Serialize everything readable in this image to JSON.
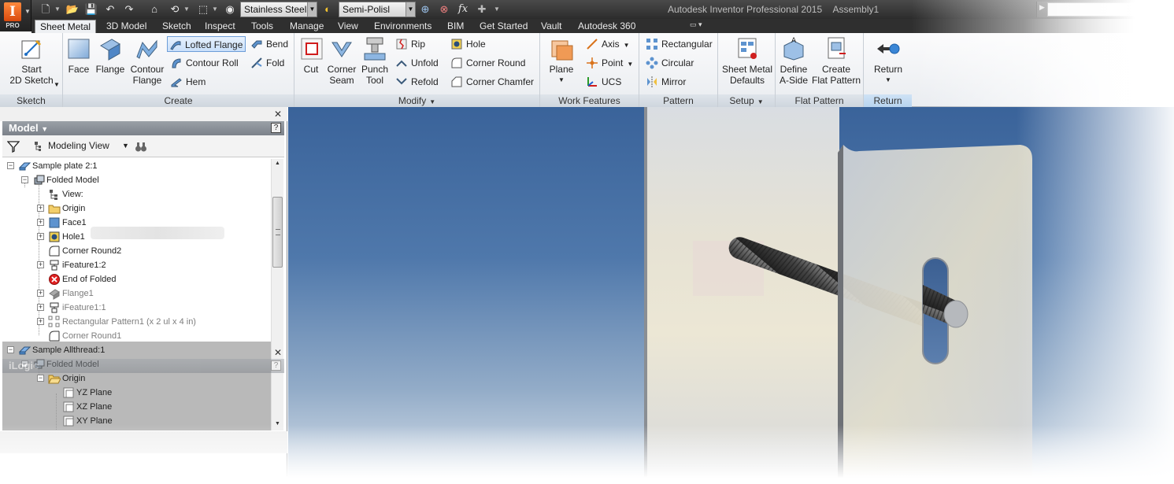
{
  "app": {
    "logo_letter": "I",
    "badge": "PRO",
    "title": "Autodesk Inventor Professional 2015",
    "document": "Assembly1"
  },
  "quick_access": {
    "material": "Stainless Steel",
    "appearance": "Semi-Polisl",
    "fx_label": "fx"
  },
  "tabs": [
    {
      "label": "Sheet Metal",
      "active": true
    },
    {
      "label": "3D Model"
    },
    {
      "label": "Sketch"
    },
    {
      "label": "Inspect"
    },
    {
      "label": "Tools"
    },
    {
      "label": "Manage"
    },
    {
      "label": "View"
    },
    {
      "label": "Environments"
    },
    {
      "label": "BIM"
    },
    {
      "label": "Get Started"
    },
    {
      "label": "Vault"
    },
    {
      "label": "Autodesk 360"
    }
  ],
  "ribbon": {
    "sketch": {
      "label": "Sketch",
      "start_sketch": "Start\n2D Sketch"
    },
    "create": {
      "label": "Create",
      "face": "Face",
      "flange": "Flange",
      "contour_flange": "Contour\nFlange",
      "lofted_flange": "Lofted Flange",
      "contour_roll": "Contour Roll",
      "hem": "Hem",
      "bend": "Bend",
      "fold": "Fold"
    },
    "modify": {
      "label": "Modify",
      "cut": "Cut",
      "corner_seam": "Corner\nSeam",
      "punch_tool": "Punch\nTool",
      "rip": "Rip",
      "unfold": "Unfold",
      "refold": "Refold",
      "hole": "Hole",
      "corner_round": "Corner Round",
      "corner_chamfer": "Corner Chamfer"
    },
    "work_features": {
      "label": "Work Features",
      "plane": "Plane",
      "axis": "Axis",
      "point": "Point",
      "ucs": "UCS"
    },
    "pattern": {
      "label": "Pattern",
      "rectangular": "Rectangular",
      "circular": "Circular",
      "mirror": "Mirror"
    },
    "setup": {
      "label": "Setup",
      "defaults": "Sheet Metal\nDefaults"
    },
    "flat_pattern": {
      "label": "Flat Pattern",
      "define_a_side": "Define\nA-Side",
      "create_flat_pattern": "Create\nFlat Pattern"
    },
    "return": {
      "label": "Return",
      "return": "Return"
    }
  },
  "browser": {
    "title": "Model",
    "help": "?",
    "view": "Modeling View",
    "tree": [
      {
        "label": "Sample plate 2:1",
        "level": 0,
        "expander": "−",
        "icon": "part-icon"
      },
      {
        "label": "Folded Model",
        "level": 1,
        "expander": "−",
        "icon": "folded-model-icon"
      },
      {
        "label": "View:",
        "level": 2,
        "expander": "",
        "icon": "view-rep-icon"
      },
      {
        "label": "Origin",
        "level": 2,
        "expander": "+",
        "icon": "folder-icon"
      },
      {
        "label": "Face1",
        "level": 2,
        "expander": "+",
        "icon": "face-icon"
      },
      {
        "label": "Hole1",
        "level": 2,
        "expander": "+",
        "icon": "hole-icon"
      },
      {
        "label": "Corner Round2",
        "level": 2,
        "expander": "",
        "icon": "corner-round-icon"
      },
      {
        "label": "iFeature1:2",
        "level": 2,
        "expander": "+",
        "icon": "ifeature-icon"
      },
      {
        "label": "End of Folded",
        "level": 2,
        "expander": "",
        "icon": "end-of-part-icon"
      },
      {
        "label": "Flange1",
        "level": 2,
        "expander": "+",
        "icon": "flange-icon",
        "dim": true
      },
      {
        "label": "iFeature1:1",
        "level": 2,
        "expander": "+",
        "icon": "ifeature-icon",
        "dim": true
      },
      {
        "label": "Rectangular Pattern1 (x 2 ul x 4 in)",
        "level": 2,
        "expander": "+",
        "icon": "rectangular-pattern-icon",
        "dim": true
      },
      {
        "label": "Corner Round1",
        "level": 2,
        "expander": "",
        "icon": "corner-round-icon",
        "dim": true
      },
      {
        "label": "Sample Allthread:1",
        "level": 0,
        "expander": "−",
        "icon": "part-icon"
      },
      {
        "label": "Folded Model",
        "level": 1,
        "expander": "−",
        "icon": "folded-model-icon"
      },
      {
        "label": "Origin",
        "level": 2,
        "expander": "−",
        "icon": "folder-open-icon"
      },
      {
        "label": "YZ Plane",
        "level": 3,
        "expander": "",
        "icon": "plane-icon"
      },
      {
        "label": "XZ Plane",
        "level": 3,
        "expander": "",
        "icon": "plane-icon"
      },
      {
        "label": "XY Plane",
        "level": 3,
        "expander": "",
        "icon": "plane-icon"
      }
    ]
  },
  "ilogic": {
    "title": "iLogic",
    "help": "?"
  },
  "colors": {
    "ribbon_highlight": "#c9e0fa",
    "viewport_top": "#3a639a",
    "viewport_bottom": "#dbe3ec",
    "error_red": "#e02020"
  }
}
